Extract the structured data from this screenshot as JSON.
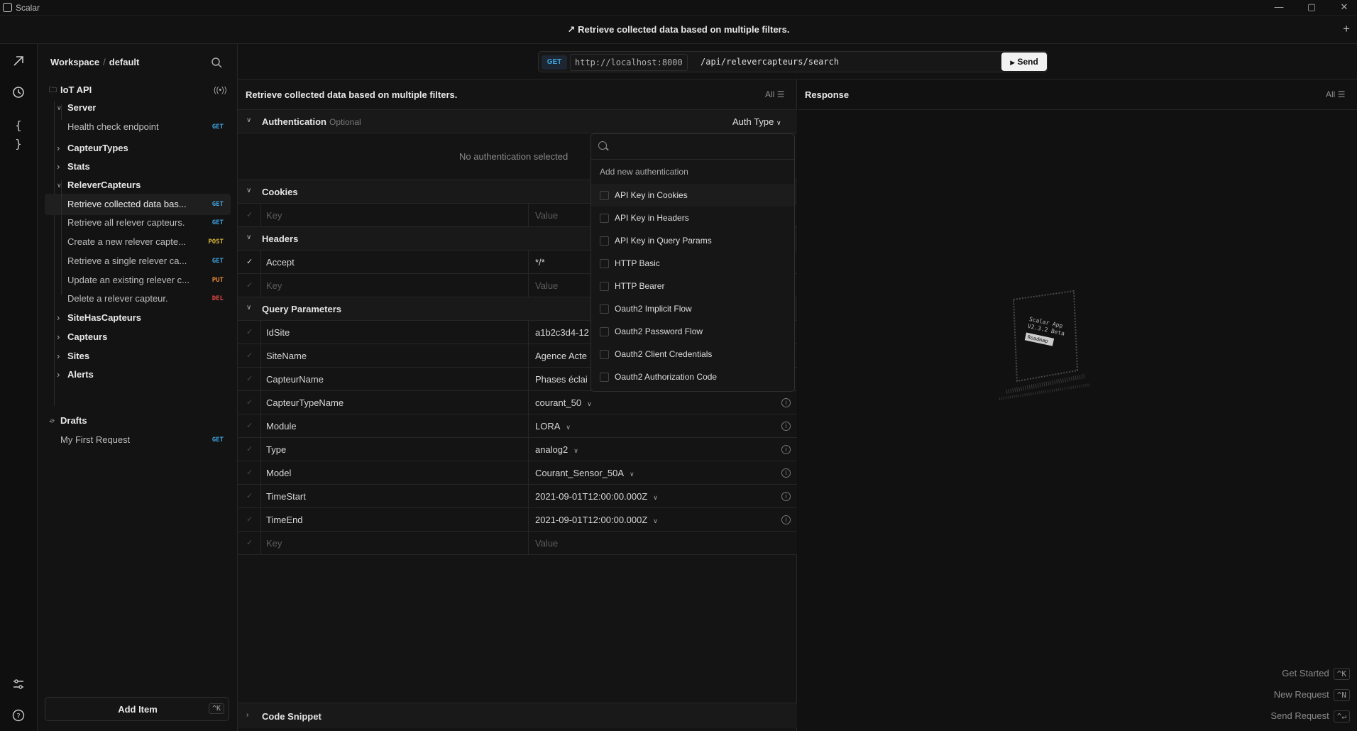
{
  "window": {
    "app_name": "Scalar",
    "tab_title": "Retrieve collected data based on multiple filters.",
    "tab_icon": "↗",
    "new_tab": "+"
  },
  "rail": {
    "icons": [
      "arrow-up-right-icon",
      "clock-icon",
      "braces-icon",
      "sliders-icon",
      "help-icon"
    ]
  },
  "sidebar": {
    "workspace": "Workspace",
    "separator": "/",
    "environment": "default",
    "collection": "IoT API",
    "tree": [
      {
        "label": "Server",
        "kind": "folder",
        "open": true
      },
      {
        "label": "Health check endpoint",
        "kind": "request",
        "method": "GET"
      },
      {
        "label": "CapteurTypes",
        "kind": "folder",
        "open": false
      },
      {
        "label": "Stats",
        "kind": "folder",
        "open": false
      },
      {
        "label": "ReleverCapteurs",
        "kind": "folder",
        "open": true
      },
      {
        "label": "Retrieve collected data bas...",
        "kind": "request",
        "method": "GET",
        "active": true
      },
      {
        "label": "Retrieve all relever capteurs.",
        "kind": "request",
        "method": "GET"
      },
      {
        "label": "Create a new relever capte...",
        "kind": "request",
        "method": "POST"
      },
      {
        "label": "Retrieve a single relever ca...",
        "kind": "request",
        "method": "GET"
      },
      {
        "label": "Update an existing relever c...",
        "kind": "request",
        "method": "PUT"
      },
      {
        "label": "Delete a relever capteur.",
        "kind": "request",
        "method": "DEL"
      },
      {
        "label": "SiteHasCapteurs",
        "kind": "folder",
        "open": false
      },
      {
        "label": "Capteurs",
        "kind": "folder",
        "open": false
      },
      {
        "label": "Sites",
        "kind": "folder",
        "open": false
      },
      {
        "label": "Alerts",
        "kind": "folder",
        "open": false
      }
    ],
    "drafts": "Drafts",
    "draft_request": {
      "label": "My First Request",
      "method": "GET"
    },
    "add_item": "Add Item",
    "add_item_shortcut": "^K"
  },
  "addressbar": {
    "method": "GET",
    "host": "http://localhost:8000",
    "path": "/api/relevercapteurs/search",
    "send": "Send"
  },
  "request": {
    "title": "Retrieve collected data based on multiple filters.",
    "filter": "All",
    "auth": {
      "label": "Authentication",
      "optional": "Optional",
      "auth_type": "Auth Type",
      "none": "No authentication selected"
    },
    "cookies": {
      "label": "Cookies",
      "key_ph": "Key",
      "value_ph": "Value"
    },
    "headers": {
      "label": "Headers",
      "rows": [
        {
          "key": "Accept",
          "value": "*/*"
        }
      ],
      "key_ph": "Key",
      "value_ph": "Value"
    },
    "query": {
      "label": "Query Parameters",
      "rows": [
        {
          "key": "IdSite",
          "value": "a1b2c3d4-12",
          "dropdown": false
        },
        {
          "key": "SiteName",
          "value": "Agence Acte",
          "dropdown": false
        },
        {
          "key": "CapteurName",
          "value": "Phases éclai",
          "dropdown": false
        },
        {
          "key": "CapteurTypeName",
          "value": "courant_50",
          "dropdown": true
        },
        {
          "key": "Module",
          "value": "LORA",
          "dropdown": true
        },
        {
          "key": "Type",
          "value": "analog2",
          "dropdown": true
        },
        {
          "key": "Model",
          "value": "Courant_Sensor_50A",
          "dropdown": true
        },
        {
          "key": "TimeStart",
          "value": "2021-09-01T12:00:00.000Z",
          "dropdown": true
        },
        {
          "key": "TimeEnd",
          "value": "2021-09-01T12:00:00.000Z",
          "dropdown": true
        }
      ],
      "key_ph": "Key",
      "value_ph": "Value"
    },
    "code_snippet": "Code Snippet"
  },
  "auth_menu": {
    "header": "Add new authentication",
    "options": [
      "API Key in Cookies",
      "API Key in Headers",
      "API Key in Query Params",
      "HTTP Basic",
      "HTTP Bearer",
      "Oauth2 Implicit Flow",
      "Oauth2 Password Flow",
      "Oauth2 Client Credentials",
      "Oauth2 Authorization Code"
    ]
  },
  "response": {
    "title": "Response",
    "filter": "All",
    "shortcuts": [
      {
        "label": "Get Started",
        "key": "^K"
      },
      {
        "label": "New Request",
        "key": "^N"
      },
      {
        "label": "Send Request",
        "key": "^↵"
      }
    ]
  },
  "colors": {
    "get": "#3fa3e0",
    "post": "#d6b33a",
    "put": "#e38a3a",
    "delete": "#e04848",
    "background": "#0f0f0f"
  }
}
